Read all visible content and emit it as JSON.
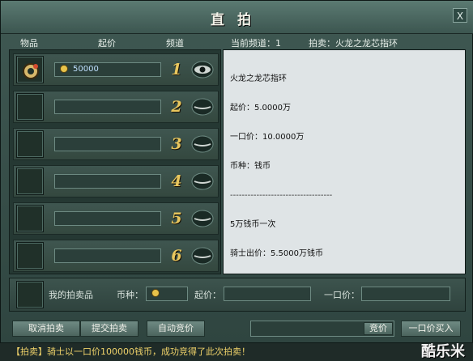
{
  "window": {
    "title": "直拍",
    "close_label": "X"
  },
  "left_headers": {
    "item": "物品",
    "price": "起价",
    "channel": "频道"
  },
  "right_headers": {
    "current_channel": "当前频道：1",
    "auction": "拍卖：火龙之龙芯指环"
  },
  "rows": [
    {
      "channel": "1",
      "price": "50000",
      "has_item": true,
      "eye_open": true
    },
    {
      "channel": "2",
      "price": "",
      "has_item": false,
      "eye_open": false
    },
    {
      "channel": "3",
      "price": "",
      "has_item": false,
      "eye_open": false
    },
    {
      "channel": "4",
      "price": "",
      "has_item": false,
      "eye_open": false
    },
    {
      "channel": "5",
      "price": "",
      "has_item": false,
      "eye_open": false
    },
    {
      "channel": "6",
      "price": "",
      "has_item": false,
      "eye_open": false
    }
  ],
  "detail": {
    "lines": [
      "火龙之龙芯指环",
      "起价：5.0000万",
      "一口价：10.0000万",
      "币种：钱币",
      "-----------------------------------",
      "5万钱币一次",
      "骑士出价：5.5000万钱币"
    ]
  },
  "my_item": {
    "label": "我的拍卖品",
    "currency_label": "币种：",
    "start_label": "起价：",
    "buyout_label": "一口价："
  },
  "buttons": {
    "cancel": "取消拍卖",
    "submit": "提交拍卖",
    "auto_bid": "自动竞价",
    "bid": "竞价",
    "buyout": "一口价买入"
  },
  "status": {
    "message": "【拍卖】骑士以一口价100000钱币，成功竞得了此次拍卖！"
  },
  "watermark": "酷乐米",
  "colors": {
    "gold_number": "#e9c75e",
    "status_text": "#f0d36a"
  }
}
